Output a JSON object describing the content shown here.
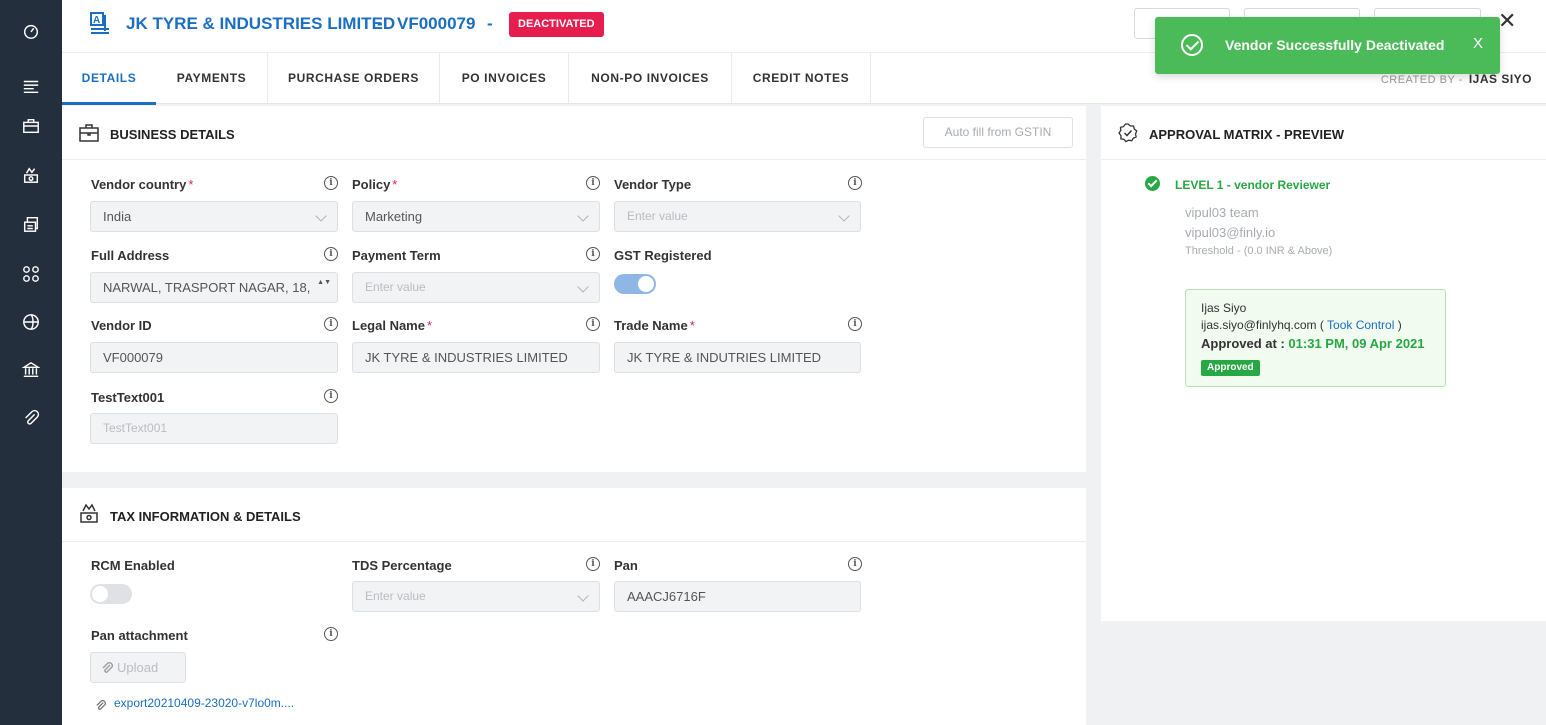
{
  "header": {
    "vendor_name": "JK TYRE & INDUSTRIES LIMITED",
    "separator": "-",
    "vendor_code": "VF000079",
    "status_badge": "DEACTIVATED",
    "close_glyph": "✕"
  },
  "tabs": [
    {
      "label": "DETAILS",
      "active": true
    },
    {
      "label": "PAYMENTS"
    },
    {
      "label": "PURCHASE ORDERS"
    },
    {
      "label": "PO INVOICES"
    },
    {
      "label": "NON-PO INVOICES"
    },
    {
      "label": "CREDIT NOTES"
    }
  ],
  "created_by": {
    "label": "CREATED BY -",
    "name": "IJAS SIYO"
  },
  "business": {
    "title": "BUSINESS DETAILS",
    "autofill_label": "Auto fill from GSTIN",
    "vendor_country": {
      "label": "Vendor country",
      "value": "India"
    },
    "policy": {
      "label": "Policy",
      "value": "Marketing"
    },
    "vendor_type": {
      "label": "Vendor Type",
      "placeholder": "Enter value"
    },
    "full_address": {
      "label": "Full Address",
      "value": "NARWAL, TRASPORT NAGAR, 18,"
    },
    "payment_term": {
      "label": "Payment Term",
      "placeholder": "Enter value"
    },
    "gst_registered": {
      "label": "GST Registered",
      "on": true
    },
    "vendor_id": {
      "label": "Vendor ID",
      "value": "VF000079"
    },
    "legal_name": {
      "label": "Legal Name",
      "value": "JK TYRE & INDUSTRIES LIMITED"
    },
    "trade_name": {
      "label": "Trade Name",
      "value": "JK TYRE & INDUTRIES LIMITED"
    },
    "test_text": {
      "label": "TestText001",
      "placeholder": "TestText001"
    },
    "required_mark": "*"
  },
  "tax": {
    "title": "TAX INFORMATION & DETAILS",
    "rcm": {
      "label": "RCM Enabled",
      "on": false
    },
    "tds": {
      "label": "TDS Percentage",
      "placeholder": "Enter value"
    },
    "pan": {
      "label": "Pan",
      "value": "AAACJ6716F"
    },
    "pan_attachment": {
      "label": "Pan attachment",
      "upload_label": "Upload",
      "file": "export20210409-23020-v7lo0m...."
    }
  },
  "approval": {
    "title": "APPROVAL MATRIX - PREVIEW",
    "level": "LEVEL 1  -  vendor Reviewer",
    "team": "vipul03 team",
    "email": "vipul03@finly.io",
    "threshold": "Threshold - (0.0 INR  & Above)",
    "approver_name": "Ijas Siyo",
    "approver_email": "ijas.siyo@finlyhq.com (",
    "took_control": "Took Control",
    "close_paren": ")",
    "approved_at_label": "Approved at :",
    "approved_at_value": "01:31 PM, 09 Apr 2021",
    "badge": "Approved"
  },
  "toast": {
    "message": "Vendor Successfully Deactivated",
    "close": "X"
  },
  "colors": {
    "accent": "#1b6ec2",
    "danger": "#e61e4d",
    "success": "#28a745",
    "toast": "#4bba59",
    "sidebar": "#242f3e"
  },
  "info_glyph": "i",
  "spinner_glyph": "▲▼"
}
